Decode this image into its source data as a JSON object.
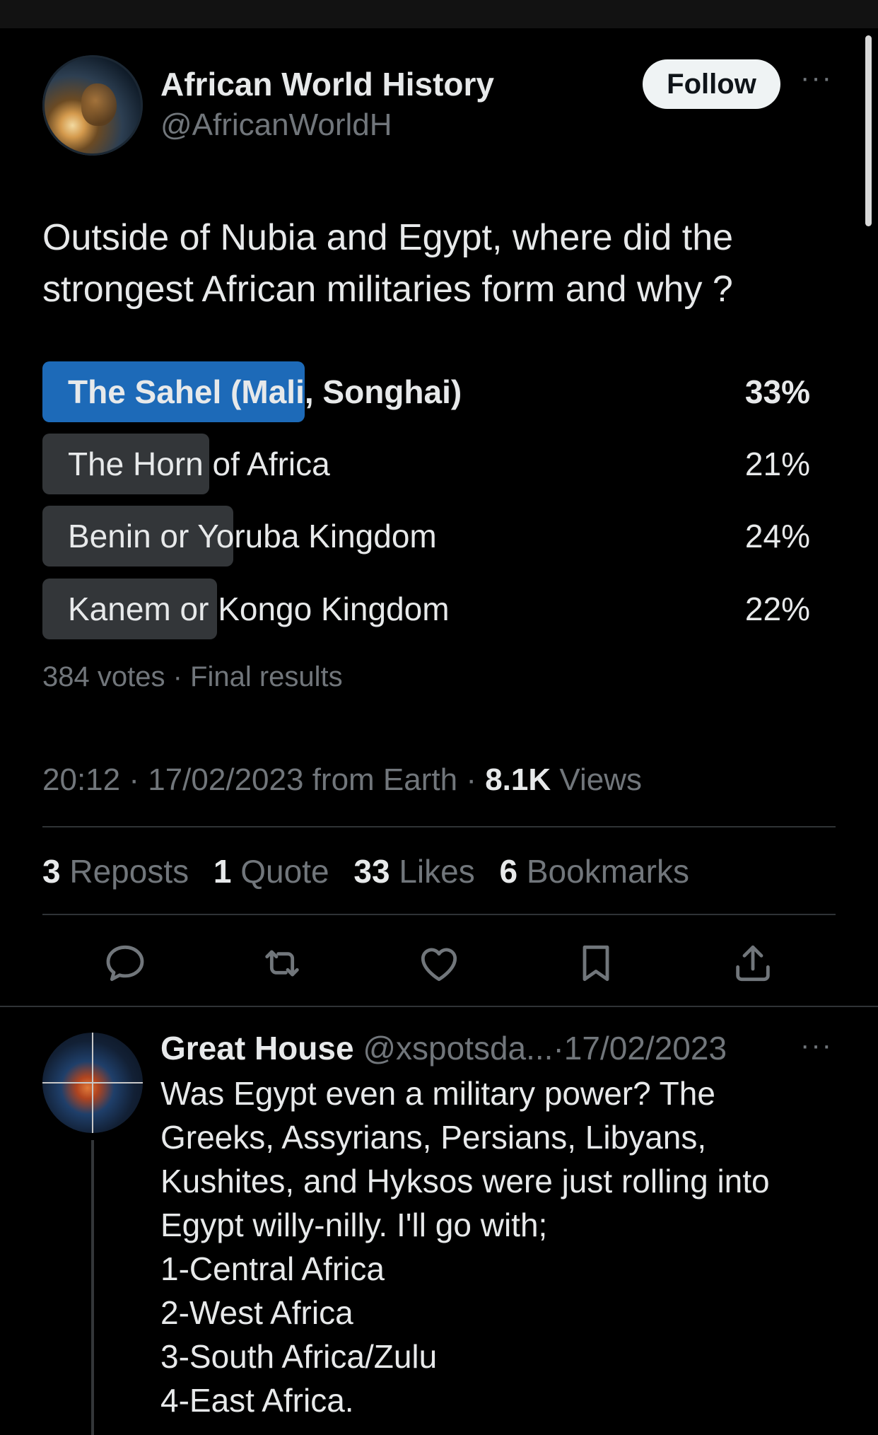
{
  "author": {
    "name": "African World History",
    "handle": "@AfricanWorldH",
    "follow_label": "Follow",
    "more_label": "···"
  },
  "tweet": {
    "text": "Outside of Nubia and Egypt, where did the strongest African militaries form and why ?"
  },
  "poll": {
    "options": [
      {
        "label": "The Sahel (Mali, Songhai)",
        "percent": "33%",
        "value": 33,
        "winner": true
      },
      {
        "label": "The Horn of Africa",
        "percent": "21%",
        "value": 21,
        "winner": false
      },
      {
        "label": "Benin or Yoruba Kingdom",
        "percent": "24%",
        "value": 24,
        "winner": false
      },
      {
        "label": "Kanem or Kongo Kingdom",
        "percent": "22%",
        "value": 22,
        "winner": false
      }
    ],
    "summary": "384 votes · Final results"
  },
  "meta": {
    "time": "20:12",
    "date": "17/02/2023",
    "source": "from Earth",
    "views_count": "8.1K",
    "views_label": "Views"
  },
  "stats": {
    "reposts": {
      "count": "3",
      "label": "Reposts"
    },
    "quotes": {
      "count": "1",
      "label": "Quote"
    },
    "likes": {
      "count": "33",
      "label": "Likes"
    },
    "bookmarks": {
      "count": "6",
      "label": "Bookmarks"
    }
  },
  "actions": [
    "reply-icon",
    "repost-icon",
    "like-icon",
    "bookmark-icon",
    "share-icon"
  ],
  "reply": {
    "name": "Great House",
    "handle": "@xspotsda...",
    "date": "17/02/2023",
    "more_label": "···",
    "lines": [
      "Was Egypt even a military power? The",
      "Greeks, Assyrians, Persians, Libyans,",
      "Kushites, and Hyksos were just rolling into",
      "Egypt willy-nilly. I'll go with;",
      "1-Central Africa",
      "2-West Africa",
      "3-South Africa/Zulu",
      "4-East Africa."
    ]
  },
  "colors": {
    "background": "#000000",
    "text": "#e7e9ea",
    "muted": "#71767b",
    "poll_winner": "#1d6ab8",
    "poll_other": "#333639"
  }
}
